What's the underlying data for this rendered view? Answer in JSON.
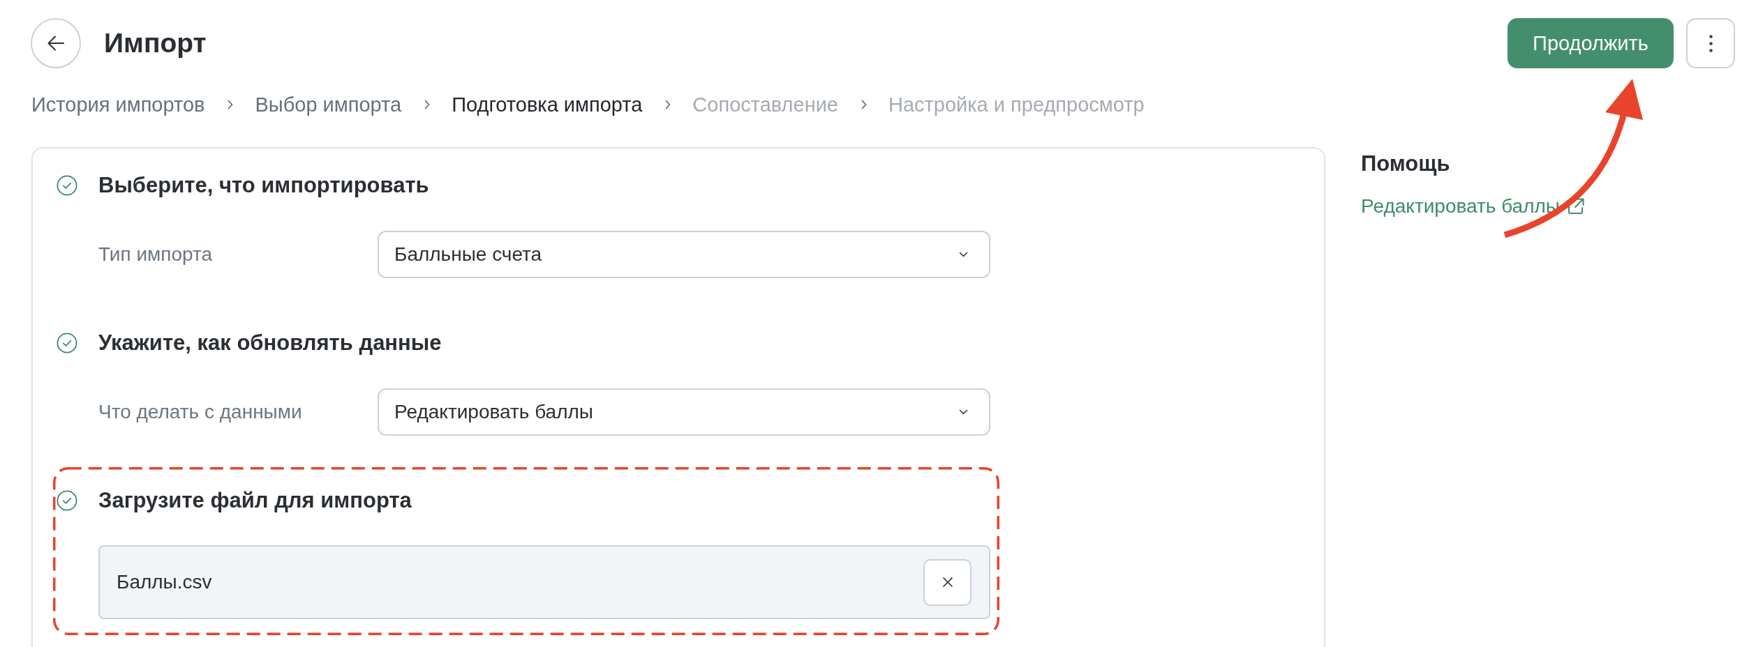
{
  "header": {
    "title": "Импорт",
    "continue_button": {
      "label": "Продолжить",
      "annotated": true
    }
  },
  "breadcrumbs": [
    {
      "label": "История импортов",
      "selected": false,
      "disabled": false
    },
    {
      "label": "Выбор импорта",
      "selected": false,
      "disabled": false
    },
    {
      "label": "Подготовка импорта",
      "selected": true,
      "disabled": false
    },
    {
      "label": "Сопоставление",
      "selected": false,
      "disabled": true
    },
    {
      "label": "Настройка и предпросмотр",
      "selected": false,
      "disabled": true
    }
  ],
  "sections": [
    {
      "kind": "select",
      "title": "Выберите, что импортировать",
      "completed": true,
      "highlighted": false,
      "label": "Тип импорта",
      "value": "Балльные счета"
    },
    {
      "kind": "select",
      "title": "Укажите, как обновлять данные",
      "completed": true,
      "highlighted": false,
      "label": "Что делать с данными",
      "value": "Редактировать баллы"
    },
    {
      "kind": "file",
      "title": "Загрузите файл для импорта",
      "completed": true,
      "highlighted": true,
      "file_name": "Баллы.csv"
    }
  ],
  "help": {
    "title": "Помощь",
    "links": [
      {
        "label": "Редактировать баллы",
        "external": true
      }
    ]
  }
}
